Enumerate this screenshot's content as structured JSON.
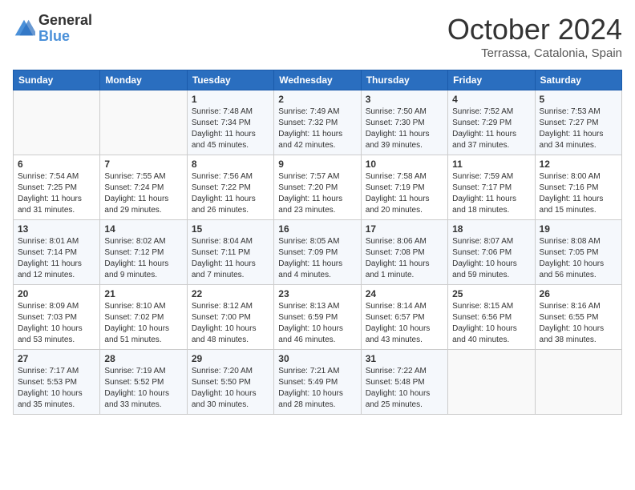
{
  "logo": {
    "general": "General",
    "blue": "Blue"
  },
  "title": "October 2024",
  "subtitle": "Terrassa, Catalonia, Spain",
  "days_of_week": [
    "Sunday",
    "Monday",
    "Tuesday",
    "Wednesday",
    "Thursday",
    "Friday",
    "Saturday"
  ],
  "weeks": [
    [
      {
        "day": "",
        "info": ""
      },
      {
        "day": "",
        "info": ""
      },
      {
        "day": "1",
        "info": "Sunrise: 7:48 AM\nSunset: 7:34 PM\nDaylight: 11 hours and 45 minutes."
      },
      {
        "day": "2",
        "info": "Sunrise: 7:49 AM\nSunset: 7:32 PM\nDaylight: 11 hours and 42 minutes."
      },
      {
        "day": "3",
        "info": "Sunrise: 7:50 AM\nSunset: 7:30 PM\nDaylight: 11 hours and 39 minutes."
      },
      {
        "day": "4",
        "info": "Sunrise: 7:52 AM\nSunset: 7:29 PM\nDaylight: 11 hours and 37 minutes."
      },
      {
        "day": "5",
        "info": "Sunrise: 7:53 AM\nSunset: 7:27 PM\nDaylight: 11 hours and 34 minutes."
      }
    ],
    [
      {
        "day": "6",
        "info": "Sunrise: 7:54 AM\nSunset: 7:25 PM\nDaylight: 11 hours and 31 minutes."
      },
      {
        "day": "7",
        "info": "Sunrise: 7:55 AM\nSunset: 7:24 PM\nDaylight: 11 hours and 29 minutes."
      },
      {
        "day": "8",
        "info": "Sunrise: 7:56 AM\nSunset: 7:22 PM\nDaylight: 11 hours and 26 minutes."
      },
      {
        "day": "9",
        "info": "Sunrise: 7:57 AM\nSunset: 7:20 PM\nDaylight: 11 hours and 23 minutes."
      },
      {
        "day": "10",
        "info": "Sunrise: 7:58 AM\nSunset: 7:19 PM\nDaylight: 11 hours and 20 minutes."
      },
      {
        "day": "11",
        "info": "Sunrise: 7:59 AM\nSunset: 7:17 PM\nDaylight: 11 hours and 18 minutes."
      },
      {
        "day": "12",
        "info": "Sunrise: 8:00 AM\nSunset: 7:16 PM\nDaylight: 11 hours and 15 minutes."
      }
    ],
    [
      {
        "day": "13",
        "info": "Sunrise: 8:01 AM\nSunset: 7:14 PM\nDaylight: 11 hours and 12 minutes."
      },
      {
        "day": "14",
        "info": "Sunrise: 8:02 AM\nSunset: 7:12 PM\nDaylight: 11 hours and 9 minutes."
      },
      {
        "day": "15",
        "info": "Sunrise: 8:04 AM\nSunset: 7:11 PM\nDaylight: 11 hours and 7 minutes."
      },
      {
        "day": "16",
        "info": "Sunrise: 8:05 AM\nSunset: 7:09 PM\nDaylight: 11 hours and 4 minutes."
      },
      {
        "day": "17",
        "info": "Sunrise: 8:06 AM\nSunset: 7:08 PM\nDaylight: 11 hours and 1 minute."
      },
      {
        "day": "18",
        "info": "Sunrise: 8:07 AM\nSunset: 7:06 PM\nDaylight: 10 hours and 59 minutes."
      },
      {
        "day": "19",
        "info": "Sunrise: 8:08 AM\nSunset: 7:05 PM\nDaylight: 10 hours and 56 minutes."
      }
    ],
    [
      {
        "day": "20",
        "info": "Sunrise: 8:09 AM\nSunset: 7:03 PM\nDaylight: 10 hours and 53 minutes."
      },
      {
        "day": "21",
        "info": "Sunrise: 8:10 AM\nSunset: 7:02 PM\nDaylight: 10 hours and 51 minutes."
      },
      {
        "day": "22",
        "info": "Sunrise: 8:12 AM\nSunset: 7:00 PM\nDaylight: 10 hours and 48 minutes."
      },
      {
        "day": "23",
        "info": "Sunrise: 8:13 AM\nSunset: 6:59 PM\nDaylight: 10 hours and 46 minutes."
      },
      {
        "day": "24",
        "info": "Sunrise: 8:14 AM\nSunset: 6:57 PM\nDaylight: 10 hours and 43 minutes."
      },
      {
        "day": "25",
        "info": "Sunrise: 8:15 AM\nSunset: 6:56 PM\nDaylight: 10 hours and 40 minutes."
      },
      {
        "day": "26",
        "info": "Sunrise: 8:16 AM\nSunset: 6:55 PM\nDaylight: 10 hours and 38 minutes."
      }
    ],
    [
      {
        "day": "27",
        "info": "Sunrise: 7:17 AM\nSunset: 5:53 PM\nDaylight: 10 hours and 35 minutes."
      },
      {
        "day": "28",
        "info": "Sunrise: 7:19 AM\nSunset: 5:52 PM\nDaylight: 10 hours and 33 minutes."
      },
      {
        "day": "29",
        "info": "Sunrise: 7:20 AM\nSunset: 5:50 PM\nDaylight: 10 hours and 30 minutes."
      },
      {
        "day": "30",
        "info": "Sunrise: 7:21 AM\nSunset: 5:49 PM\nDaylight: 10 hours and 28 minutes."
      },
      {
        "day": "31",
        "info": "Sunrise: 7:22 AM\nSunset: 5:48 PM\nDaylight: 10 hours and 25 minutes."
      },
      {
        "day": "",
        "info": ""
      },
      {
        "day": "",
        "info": ""
      }
    ]
  ]
}
